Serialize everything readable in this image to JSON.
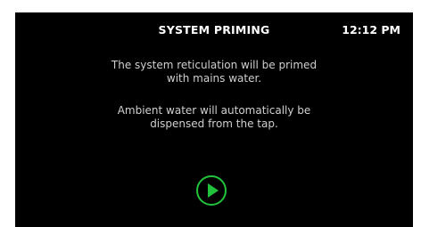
{
  "header": {
    "title": "SYSTEM PRIMING",
    "time": "12:12  PM"
  },
  "messages": [
    {
      "line1": "The system reticulation will be primed",
      "line2": "with mains water."
    },
    {
      "line1": "Ambient water will automatically be",
      "line2": "dispensed from the tap."
    }
  ],
  "play_button": {
    "icon": "play-icon",
    "color": "#22c33c"
  },
  "colors": {
    "background": "#000000",
    "text": "#cfcfcf",
    "accent": "#22c33c"
  }
}
